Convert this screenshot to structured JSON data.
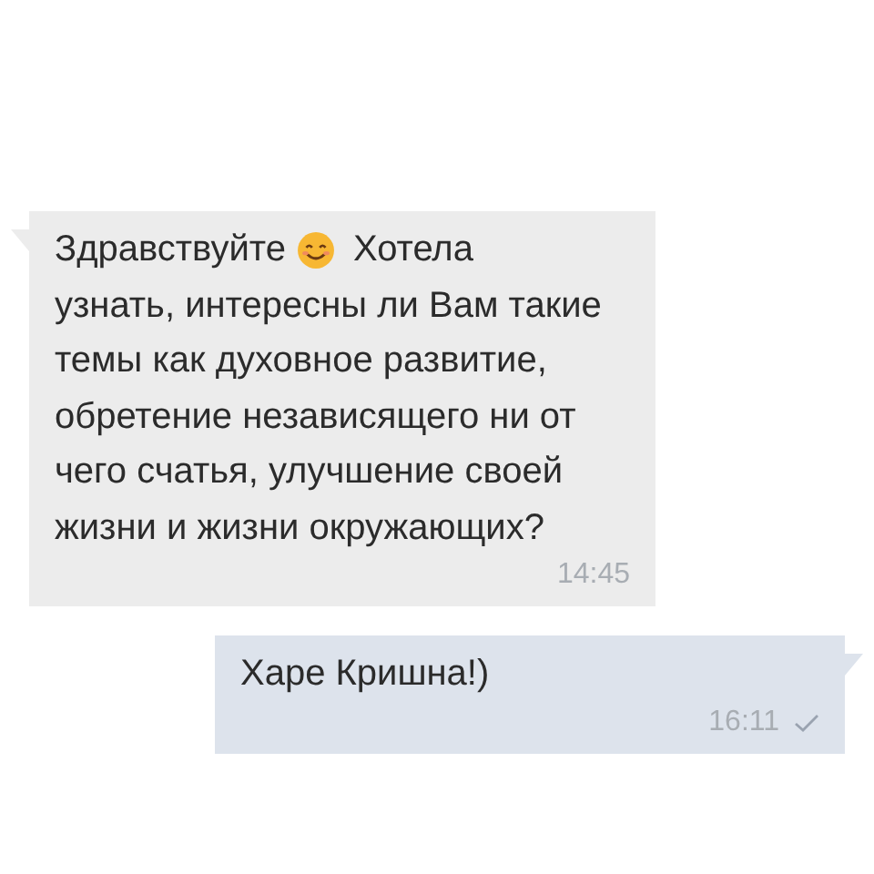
{
  "messages": [
    {
      "kind": "incoming",
      "parts": [
        {
          "kind": "text",
          "text": "Здравствуйте"
        },
        {
          "kind": "emoji"
        },
        {
          "kind": "text",
          "text": "Хотела"
        },
        {
          "kind": "paragraph",
          "text": "узнать, интересны ли Вам такие темы как духовное развитие, обретение независящего ни от чего счатья, улучшение своей жизни и жизни окружающих?"
        }
      ],
      "time": "14:45",
      "read": false
    },
    {
      "kind": "outgoing",
      "parts": [
        {
          "kind": "text",
          "text": "Харе Кришна!)"
        }
      ],
      "time": "16:11",
      "read": true
    }
  ]
}
